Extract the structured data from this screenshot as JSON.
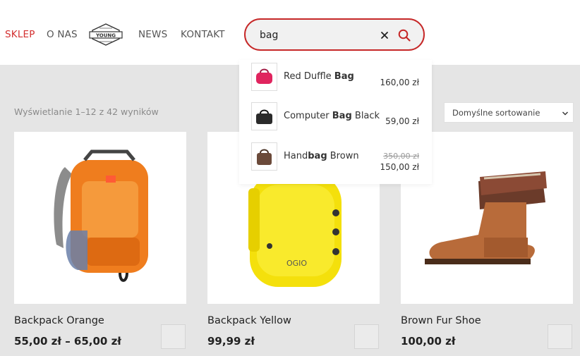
{
  "nav": {
    "items": [
      {
        "label": "SKLEP",
        "active": true
      },
      {
        "label": "O NAS",
        "active": false
      },
      {
        "label": "NEWS",
        "active": false
      },
      {
        "label": "KONTAKT",
        "active": false
      }
    ],
    "logo_text": "YOUNG"
  },
  "search": {
    "value": "bag",
    "clear_icon": "close-icon",
    "submit_icon": "search-icon",
    "accent_color": "#c62828"
  },
  "suggestions": [
    {
      "name_before": "Red Duffle ",
      "name_match": "Bag",
      "name_after": "",
      "price": "160,00 zł",
      "old_price": ""
    },
    {
      "name_before": "Computer ",
      "name_match": "Bag",
      "name_after": " Black",
      "price": "59,00 zł",
      "old_price": ""
    },
    {
      "name_before": "Hand",
      "name_match": "bag",
      "name_after": " Brown",
      "price": "150,00 zł",
      "old_price": "350,00 zł"
    }
  ],
  "results": {
    "count_text": "Wyświetlanie 1–12 z 42 wyników",
    "sort_selected": "Domyślne sortowanie"
  },
  "products": [
    {
      "name": "Backpack Orange",
      "price": "55,00 zł – 65,00 zł"
    },
    {
      "name": "Backpack Yellow",
      "price": "99,99 zł"
    },
    {
      "name": "Brown Fur Shoe",
      "price": "100,00 zł"
    }
  ]
}
